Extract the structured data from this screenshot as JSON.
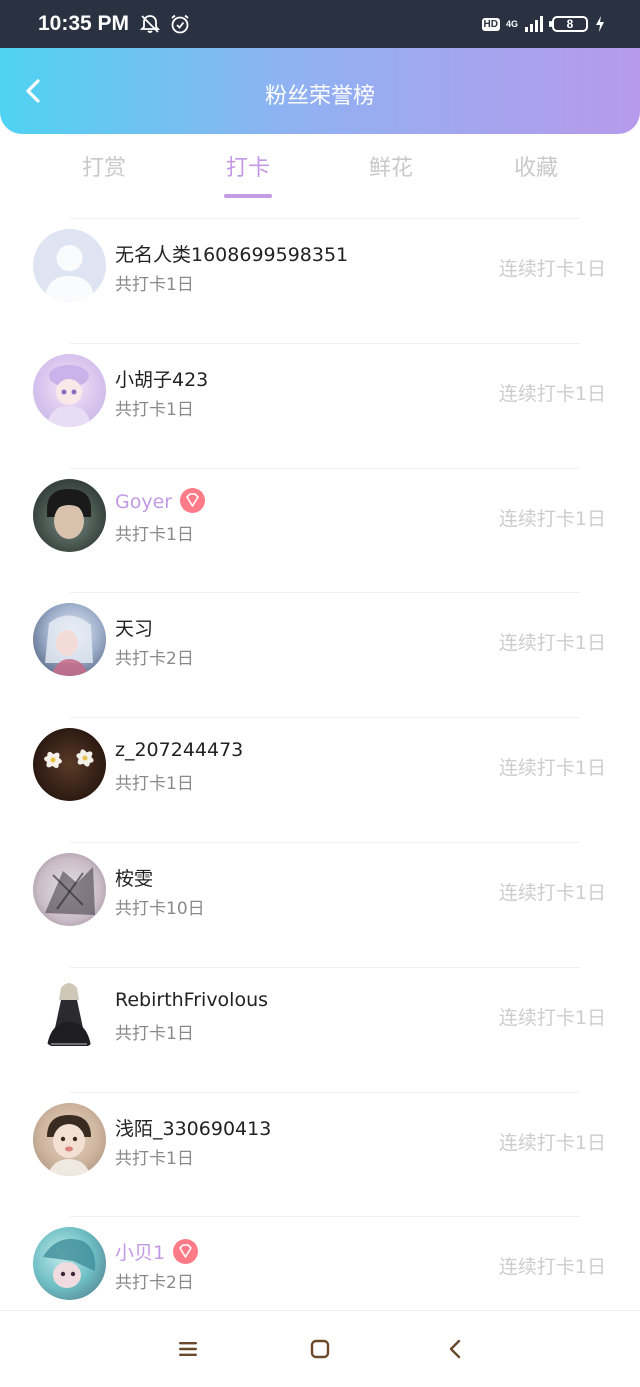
{
  "status_bar": {
    "time": "10:35 PM",
    "hd": "HD",
    "network": "4G",
    "battery": "8",
    "icons": [
      "bell-off-icon",
      "alarm-icon",
      "signal-icon",
      "charging-icon"
    ]
  },
  "header": {
    "title": "粉丝荣誉榜",
    "back_icon": "chevron-left-icon",
    "gradient": [
      "#4fd3f2",
      "#b79aec"
    ]
  },
  "tabs": [
    {
      "label": "打赏",
      "active": false
    },
    {
      "label": "打卡",
      "active": true
    },
    {
      "label": "鲜花",
      "active": false
    },
    {
      "label": "收藏",
      "active": false
    }
  ],
  "colors": {
    "accent": "#c39ae6",
    "vip_badge": "#ff7b88",
    "muted_text": "#cdcdcd"
  },
  "fans": [
    {
      "name": "无名人类1608699598351",
      "total": "共打卡1日",
      "streak": "连续打卡1日",
      "vip": false,
      "avatar": "default-avatar"
    },
    {
      "name": "小胡子423",
      "total": "共打卡1日",
      "streak": "连续打卡1日",
      "vip": false,
      "avatar": "anime-girl-avatar"
    },
    {
      "name": "Goyer",
      "total": "共打卡1日",
      "streak": "连续打卡1日",
      "vip": true,
      "avatar": "boy-portrait-avatar"
    },
    {
      "name": "天习",
      "total": "共打卡2日",
      "streak": "连续打卡1日",
      "vip": false,
      "avatar": "anime-character-avatar"
    },
    {
      "name": "z_207244473",
      "total": "共打卡1日",
      "streak": "连续打卡1日",
      "vip": false,
      "avatar": "flowers-avatar"
    },
    {
      "name": "桉雯",
      "total": "共打卡10日",
      "streak": "连续打卡1日",
      "vip": false,
      "avatar": "sketch-avatar"
    },
    {
      "name": "RebirthFrivolous",
      "total": "共打卡1日",
      "streak": "连续打卡1日",
      "vip": false,
      "avatar": "gothic-doll-avatar"
    },
    {
      "name": "浅陌_330690413",
      "total": "共打卡1日",
      "streak": "连续打卡1日",
      "vip": false,
      "avatar": "baby-photo-avatar"
    },
    {
      "name": "小贝1",
      "total": "共打卡2日",
      "streak": "连续打卡1日",
      "vip": true,
      "avatar": "anime-cyan-avatar"
    }
  ],
  "nav": [
    "menu-icon",
    "home-square-icon",
    "back-triangle-icon"
  ]
}
